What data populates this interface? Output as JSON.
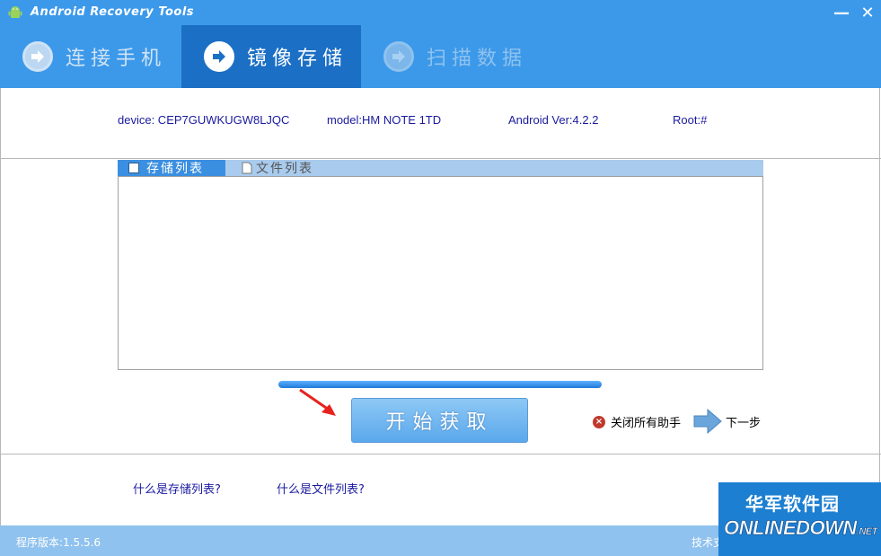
{
  "window": {
    "title": "Android Recovery Tools",
    "minimize_glyph": "—",
    "close_glyph": "✕"
  },
  "steps": [
    {
      "label": "连接手机",
      "state": "done"
    },
    {
      "label": "镜像存储",
      "state": "active"
    },
    {
      "label": "扫描数据",
      "state": "pending"
    }
  ],
  "device_info": {
    "device": "device: CEP7GUWKUGW8LJQC",
    "model": "model:HM NOTE 1TD",
    "android": "Android Ver:4.2.2",
    "root": "Root:#"
  },
  "tabs": [
    {
      "label": "存储列表",
      "active": true
    },
    {
      "label": "文件列表",
      "active": false
    }
  ],
  "progress": {
    "fraction": 1.0
  },
  "actions": {
    "start_label": "开始获取",
    "close_helpers_label": "关闭所有助手",
    "next_label": "下一步"
  },
  "help_links": {
    "storage_list": "什么是存储列表?",
    "file_list": "什么是文件列表?"
  },
  "status": {
    "version": "程序版本:1.5.5.6",
    "support": "技术支"
  },
  "watermark": {
    "cn": "华军软件园",
    "en": "ONLINEDOWN",
    "suffix": ".NET"
  },
  "colors": {
    "accent": "#3c99ea",
    "active_step": "#1b6fc5",
    "link": "#1a1aa0"
  }
}
